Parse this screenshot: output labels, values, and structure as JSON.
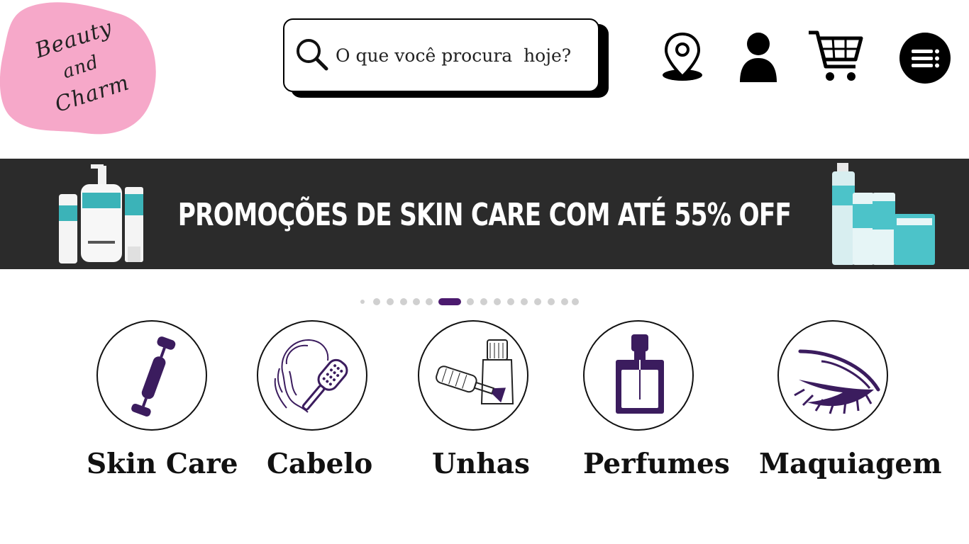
{
  "logo": {
    "line1": "Beauty",
    "line2": "and",
    "line3": "Charm",
    "blob_color": "#f6a8c9"
  },
  "search": {
    "placeholder": "O que você procura  hoje?",
    "value": ""
  },
  "header_icons": [
    "location-pin-icon",
    "user-icon",
    "cart-icon",
    "menu-icon"
  ],
  "banner": {
    "title": "PROMOÇÕES DE SKIN CARE COM ATÉ  55% OFF",
    "background": "#2b2b2b"
  },
  "carousel": {
    "dot_count": 16,
    "active_index": 6,
    "active_color": "#4b1a6e"
  },
  "categories": [
    {
      "label": "Skin Care",
      "icon": "face-roller-icon"
    },
    {
      "label": "Cabelo",
      "icon": "hair-brush-icon"
    },
    {
      "label": "Unhas",
      "icon": "nail-polish-icon"
    },
    {
      "label": "Perfumes",
      "icon": "perfume-bottle-icon"
    },
    {
      "label": "Maquiagem",
      "icon": "eyelash-icon"
    }
  ],
  "accent_color": "#3b1c5e"
}
